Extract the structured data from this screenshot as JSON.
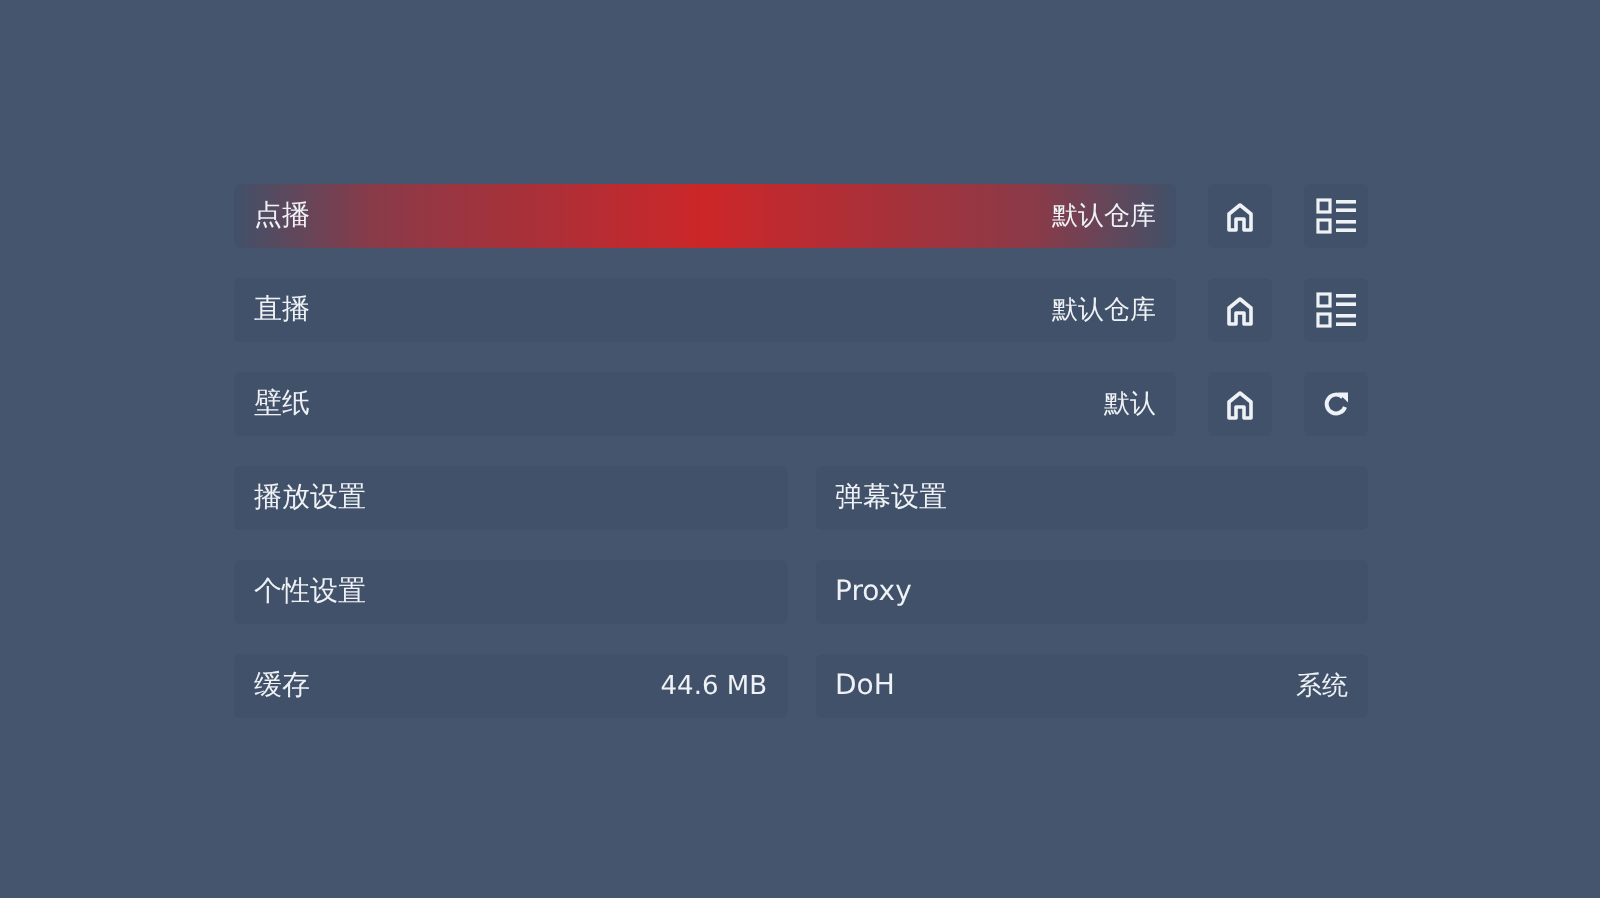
{
  "source_rows": [
    {
      "label": "点播",
      "value": "默认仓库",
      "selected": true,
      "buttons": [
        {
          "kind": "home"
        },
        {
          "kind": "list"
        }
      ]
    },
    {
      "label": "直播",
      "value": "默认仓库",
      "selected": false,
      "buttons": [
        {
          "kind": "home"
        },
        {
          "kind": "list"
        }
      ]
    },
    {
      "label": "壁纸",
      "value": "默认",
      "selected": false,
      "buttons": [
        {
          "kind": "home"
        },
        {
          "kind": "refresh"
        }
      ]
    }
  ],
  "settings": [
    {
      "label": "播放设置",
      "selected": false
    },
    {
      "label": "弹幕设置",
      "selected": false
    },
    {
      "label": "个性设置",
      "selected": false
    },
    {
      "label": "Proxy",
      "selected": false
    },
    {
      "label": "缓存",
      "value": "44.6 MB",
      "selected": false
    },
    {
      "label": "DoH",
      "value": "系统",
      "selected": false
    }
  ]
}
